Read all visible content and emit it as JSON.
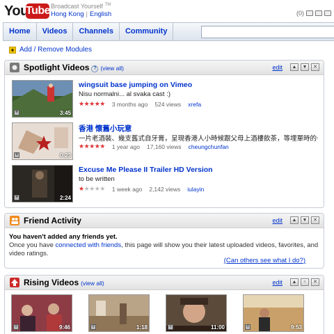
{
  "header": {
    "logo_you": "You",
    "logo_tube": "Tube",
    "tagline": "Broadcast Yourself",
    "trademark": "TM",
    "region": "Hong Kong",
    "language": "English",
    "count": "(0)"
  },
  "nav": {
    "tabs": [
      "Home",
      "Videos",
      "Channels",
      "Community"
    ],
    "search_placeholder": ""
  },
  "add_modules": "Add / Remove Modules",
  "spotlight": {
    "title": "Spotlight Videos",
    "help": "?",
    "view_all": "(view all)",
    "edit": "edit",
    "videos": [
      {
        "title": "wingsuit base jumping on Vimeo",
        "desc": "Nisu normalni... al svaka cast :)",
        "rating": 5,
        "age": "3 months ago",
        "views": "524 views",
        "author": "xrefa",
        "duration": "3:45"
      },
      {
        "title": "香港 懷舊小玩意",
        "desc": "一片老酒裝、幾支舊式自牙膏，呈現香港人小時候跟父母上酒樓飲茶，等埋單時的一種",
        "rating": 5,
        "age": "1 year ago",
        "views": "17,160 views",
        "author": "cheungchunfan",
        "duration": "0:23"
      },
      {
        "title": "Excuse Me Please II Trailer HD Version",
        "desc": "to be written",
        "rating": 1,
        "age": "1 week ago",
        "views": "2,142 views",
        "author": "iulayin",
        "duration": "2:24"
      }
    ]
  },
  "friend_activity": {
    "title": "Friend Activity",
    "edit": "edit",
    "headline": "You haven't added any friends yet.",
    "line_pre": "Once you have ",
    "line_link": "connected with friends",
    "line_post": ", this page will show you their latest uploaded videos, favorites, and video ratings.",
    "others_link": "(Can others see what I do?)"
  },
  "rising": {
    "title": "Rising Videos",
    "view_all": "(view all)",
    "edit": "edit",
    "durations": [
      "9:46",
      "1:18",
      "11:00",
      "9:53"
    ]
  },
  "colors": {
    "link": "#0033cc",
    "brand_red": "#cc1a1a",
    "star_on": "#dd3333"
  }
}
